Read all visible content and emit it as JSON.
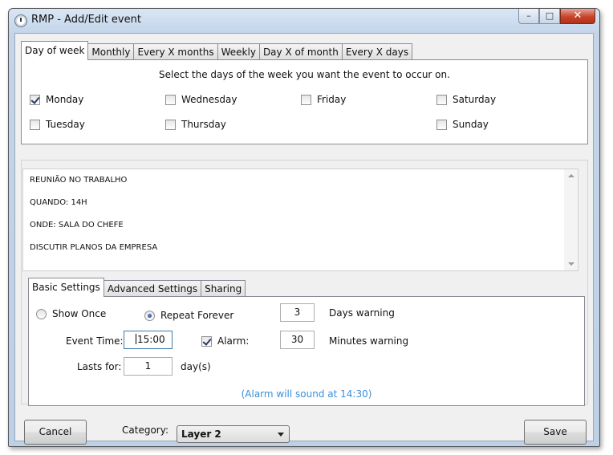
{
  "window": {
    "title": "RMP - Add/Edit event",
    "minimize_glyph": "–",
    "maximize_glyph": "□",
    "close_glyph": "✕"
  },
  "recurrence_tabs": [
    {
      "label": "Day of week",
      "active": true
    },
    {
      "label": "Monthly",
      "active": false
    },
    {
      "label": "Every X months",
      "active": false
    },
    {
      "label": "Weekly",
      "active": false
    },
    {
      "label": "Day X of month",
      "active": false
    },
    {
      "label": "Every X days",
      "active": false
    }
  ],
  "day_of_week": {
    "instruction": "Select the days of the week you want the event to occur on.",
    "days": [
      {
        "label": "Monday",
        "checked": true
      },
      {
        "label": "Tuesday",
        "checked": false
      },
      {
        "label": "Wednesday",
        "checked": false
      },
      {
        "label": "Thursday",
        "checked": false
      },
      {
        "label": "Friday",
        "checked": false
      },
      {
        "label": "Saturday",
        "checked": false
      },
      {
        "label": "Sunday",
        "checked": false
      }
    ]
  },
  "memo": {
    "lines": [
      "REUNIÃO NO TRABALHO",
      "QUANDO: 14H",
      "ONDE: SALA DO CHEFE",
      "DISCUTIR PLANOS DA EMPRESA"
    ]
  },
  "settings_tabs": [
    {
      "label": "Basic Settings",
      "active": true
    },
    {
      "label": "Advanced Settings",
      "active": false
    },
    {
      "label": "Sharing",
      "active": false
    }
  ],
  "basic": {
    "show_once_label": "Show Once",
    "repeat_forever_label": "Repeat Forever",
    "repeat_mode": "repeat_forever",
    "days_warning_value": "3",
    "days_warning_label": "Days warning",
    "event_time_label": "Event Time:",
    "event_time_value": "15:00",
    "alarm_label": "Alarm:",
    "alarm_checked": true,
    "minutes_warning_value": "30",
    "minutes_warning_label": "Minutes warning",
    "lasts_for_label": "Lasts for:",
    "lasts_for_value": "1",
    "lasts_for_unit": "day(s)",
    "alarm_message": "(Alarm will sound at 14:30)"
  },
  "footer": {
    "cancel_label": "Cancel",
    "category_label": "Category:",
    "category_value": "Layer 2",
    "save_label": "Save"
  },
  "colors": {
    "alarm_message": "#3a90d8",
    "close_button": "#c7432a"
  }
}
